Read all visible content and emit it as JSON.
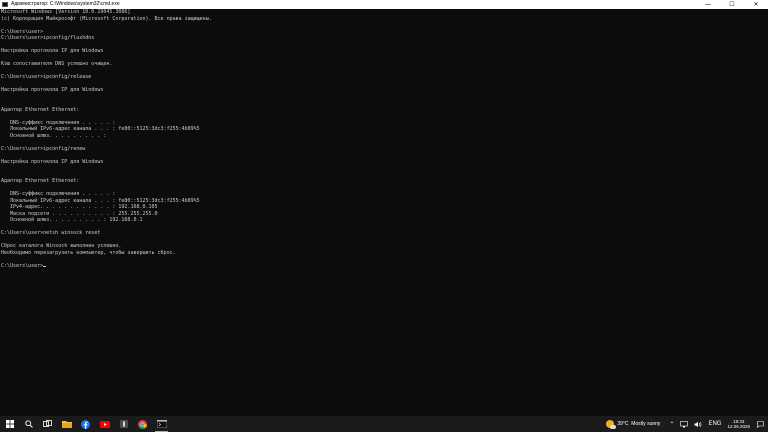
{
  "window": {
    "title": "Администратор: C:\\Windows\\system32\\cmd.exe",
    "minimize_glyph": "—",
    "maximize_glyph": "☐",
    "close_glyph": "✕"
  },
  "console": {
    "lines": [
      "Microsoft Windows [Version 10.0.19045.3086]",
      "(c) Корпорация Майкрософт (Microsoft Corporation). Все права защищены.",
      "",
      "C:\\Users\\user>",
      "C:\\Users\\user>ipconfig/flushdns",
      "",
      "Настройка протокола IP для Windows",
      "",
      "Кэш сопоставителя DNS успешно очищен.",
      "",
      "C:\\Users\\user>ipconfig/release",
      "",
      "Настройка протокола IP для Windows",
      "",
      "",
      "Адаптер Ethernet Ethernet:",
      "",
      "   DNS-суффикс подключения . . . . . :",
      "   Локальный IPv6-адрес канала . . . : fe80::5125:3dc3:f255:4b89%5",
      "   Основной шлюз. . . . . . . . . :",
      "",
      "C:\\Users\\user>ipconfig/renew",
      "",
      "Настройка протокола IP для Windows",
      "",
      "",
      "Адаптер Ethernet Ethernet:",
      "",
      "   DNS-суффикс подключения . . . . . :",
      "   Локальный IPv6-адрес канала . . . : fe80::5125:3dc3:f255:4b89%5",
      "   IPv4-адрес. . . . . . . . . . . . : 192.168.0.105",
      "   Маска подсети . . . . . . . . . . : 255.255.255.0",
      "   Основной шлюз. . . . . . . . . : 192.168.0.1",
      "",
      "C:\\Users\\user>netsh winsock reset",
      "",
      "Сброс каталога Winsock выполнен успешно.",
      "Необходимо перезагрузить компьютер, чтобы завершить сброс.",
      "",
      ""
    ],
    "prompt": "C:\\Users\\user>"
  },
  "taskbar": {
    "items": [
      "windows-start",
      "search",
      "task-view",
      "file-explorer",
      "facebook",
      "youtube",
      "app",
      "chrome",
      "terminal"
    ],
    "weather_temp": "39°C",
    "weather_text": "Mostly sunny",
    "lang": "ENG",
    "time": "18:33",
    "date": "12.06.2026",
    "colors": {
      "start": "#ffffff",
      "facebook": "#1877f2",
      "youtube": "#ff0000",
      "chrome": "#34a853",
      "accent": "#76b9ed"
    }
  }
}
